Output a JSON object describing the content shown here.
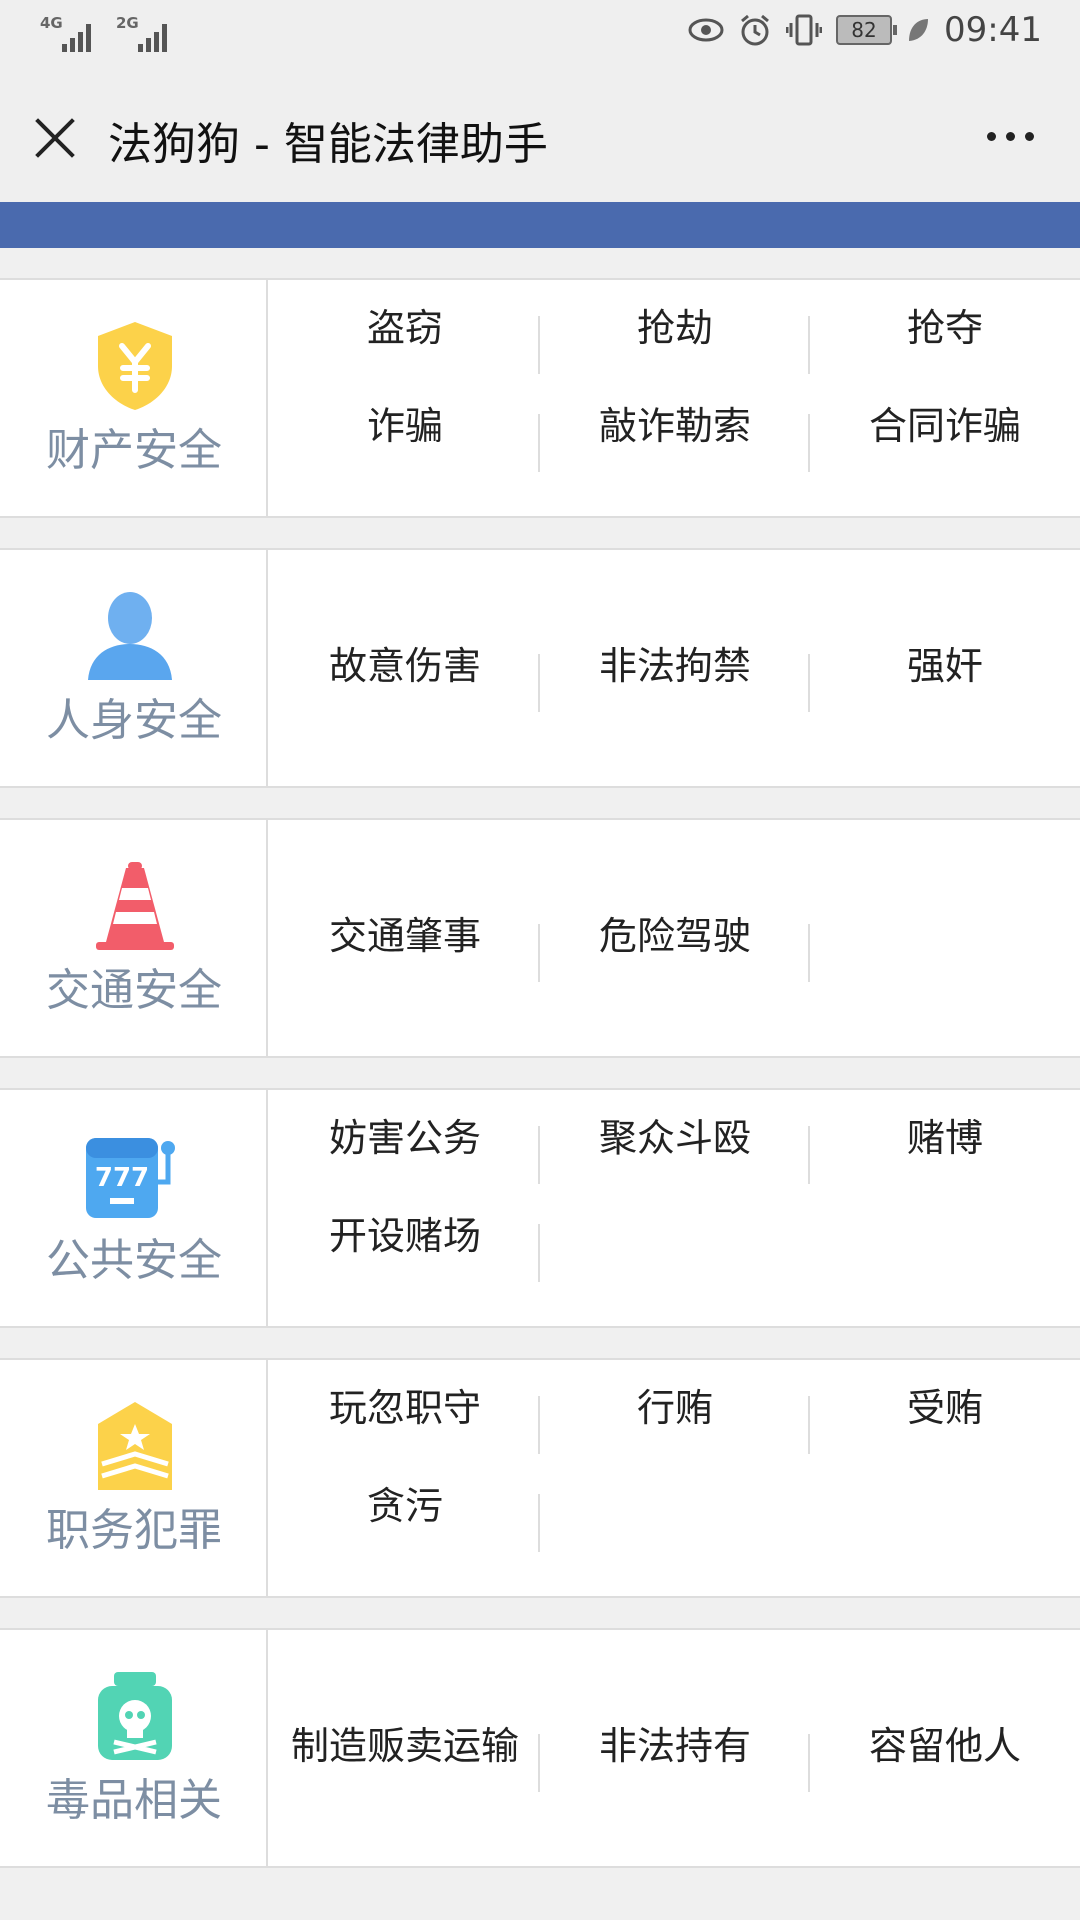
{
  "status": {
    "net1": "4G",
    "net2": "2G",
    "battery": "82",
    "time": "09:41"
  },
  "titlebar": {
    "title": "法狗狗 - 智能法律助手"
  },
  "sections": [
    {
      "label": "财产安全",
      "icon": "shield-yen-icon",
      "rows": [
        [
          "盗窃",
          "抢劫",
          "抢夺"
        ],
        [
          "诈骗",
          "敲诈勒索",
          "合同诈骗"
        ]
      ]
    },
    {
      "label": "人身安全",
      "icon": "person-icon",
      "rows": [
        [
          "故意伤害",
          "非法拘禁",
          "强奸"
        ]
      ]
    },
    {
      "label": "交通安全",
      "icon": "traffic-cone-icon",
      "rows": [
        [
          "交通肇事",
          "危险驾驶"
        ]
      ]
    },
    {
      "label": "公共安全",
      "icon": "slot-machine-icon",
      "rows": [
        [
          "妨害公务",
          "聚众斗殴",
          "赌博"
        ],
        [
          "开设赌场"
        ]
      ]
    },
    {
      "label": "职务犯罪",
      "icon": "rank-badge-icon",
      "rows": [
        [
          "玩忽职守",
          "行贿",
          "受贿"
        ],
        [
          "贪污"
        ]
      ]
    },
    {
      "label": "毒品相关",
      "icon": "poison-bottle-icon",
      "rows": [
        [
          "制造贩卖运输",
          "非法持有",
          "容留他人"
        ]
      ]
    }
  ]
}
